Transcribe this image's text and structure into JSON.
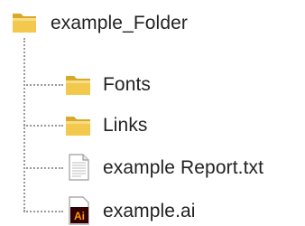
{
  "tree": {
    "root": {
      "label": "example_Folder",
      "icon": "folder-icon"
    },
    "children": [
      {
        "label": "Fonts",
        "icon": "folder-icon"
      },
      {
        "label": "Links",
        "icon": "folder-icon"
      },
      {
        "label": "example Report.txt",
        "icon": "text-file-icon"
      },
      {
        "label": "example.ai",
        "icon": "illustrator-file-icon"
      }
    ]
  },
  "colors": {
    "folder_fill": "#f2c94c",
    "folder_tab": "#d9a928",
    "connector": "#9a9a9a",
    "ai_badge_bg": "#330000",
    "ai_badge_text": "#ff9a00"
  }
}
